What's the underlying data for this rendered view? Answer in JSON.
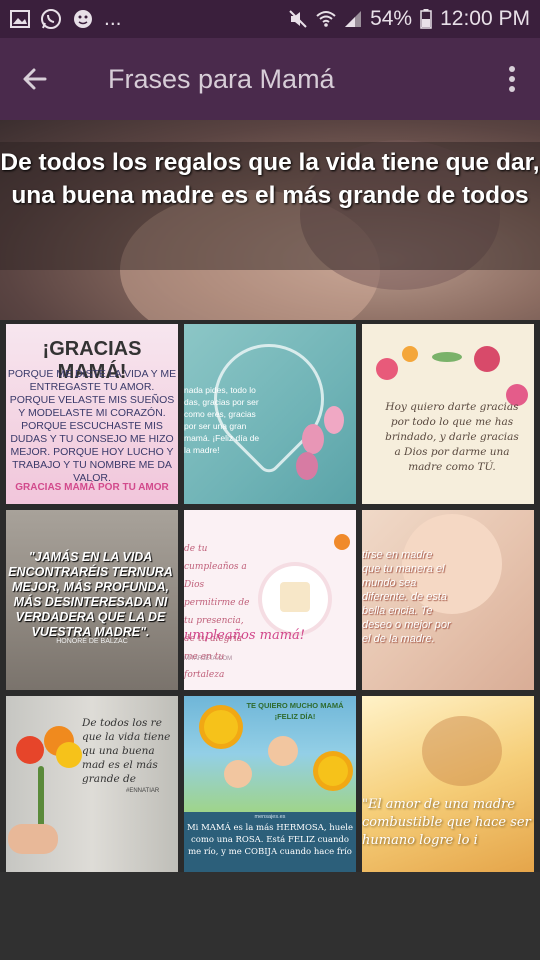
{
  "status_bar": {
    "battery": "54%",
    "time": "12:00 PM",
    "left_icons": [
      "image-icon",
      "whatsapp-icon",
      "face-icon"
    ],
    "more": "...",
    "right_icons": [
      "mute-icon",
      "wifi-icon",
      "signal-icon",
      "battery-icon"
    ]
  },
  "app_bar": {
    "title": "Frases para Mamá",
    "back_icon": "arrow-left-icon",
    "menu_icon": "more-vertical-icon",
    "background": "#4a2a4c"
  },
  "featured": {
    "quote": "De todos los regalos que la vida tiene que dar, una buena madre es el más grande de todos"
  },
  "gallery": [
    {
      "heading": "¡GRACIAS MAMÁ!",
      "lines": "PORQUE ME DISTE LA VIDA Y ME ENTREGASTE TU AMOR. PORQUE VELASTE MIS SUEÑOS Y MODELASTE MI CORAZÓN. PORQUE ESCUCHASTE MIS DUDAS Y TU CONSEJO ME HIZO MEJOR. PORQUE HOY LUCHO Y TRABAJO Y TU NOMBRE ME DA VALOR.",
      "footer": "GRACIAS MAMÁ POR TU AMOR"
    },
    {
      "text": "nada pides, todo lo das, gracias por ser como eres, gracias por ser una gran mamá. ¡Feliz día de la madre!"
    },
    {
      "text": "Hoy quiero darte gracias por todo lo que me has brindado, y darle gracias a Dios por darme una madre como TÚ."
    },
    {
      "text": "\"JAMÁS EN LA VIDA ENCONTRARÉIS TERNURA MEJOR, MÁS PROFUNDA, MÁS DESINTERESADA NI VERDADERA QUE LA DE VUESTRA MADRE\".",
      "author": "HONORÉ DE BALZAC"
    },
    {
      "text": "de tu cumpleaños a Dios permitirme de tu presencia, de tu alegría me en tu fortaleza",
      "big": "umpleaños mamá!",
      "small": "MITARJETA.COM"
    },
    {
      "text": "tirse en madre que tu manera el mundo sea diferente. de esta bella encia. Te deseo o mejor por el de la madre."
    },
    {
      "text": "De todos los re que la vida tiene qu una buena mad es el más grande de",
      "author": "#ENNATIAR"
    },
    {
      "banner": "TE QUIERO MUCHO MAMÁ ¡FELIZ DÍA!",
      "credit": "mensajes.es",
      "poem": "Mi MAMÁ es la más HERMOSA, huele como una ROSA. Está FELIZ cuando me río, y me COBIJA cuando hace frío"
    },
    {
      "text": "\"El amor de una madre combustible que hace ser humano logre lo i"
    }
  ]
}
